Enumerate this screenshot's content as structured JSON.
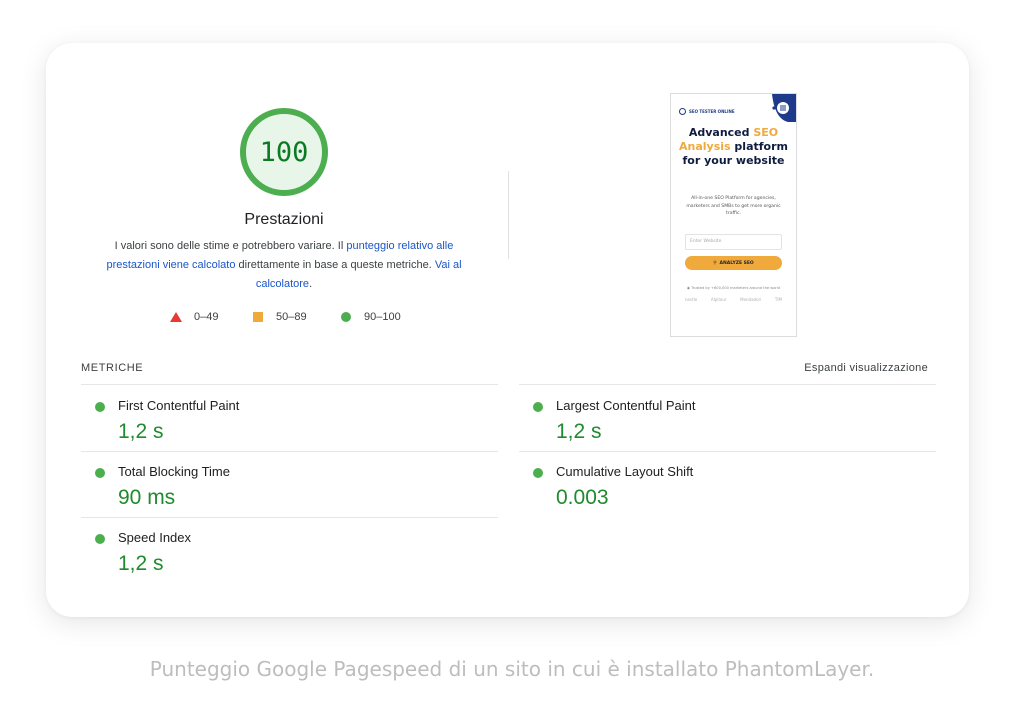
{
  "score": {
    "value": "100",
    "title": "Prestazioni",
    "fraction": 1.0,
    "color": "#0b7a23",
    "ring_color": "#4cae4f",
    "fill_color": "#e8f5e9"
  },
  "description": {
    "part1": "I valori sono delle stime e potrebbero variare. Il ",
    "link1": "punteggio relativo alle prestazioni viene calcolato",
    "part2": " direttamente in base a queste metriche. ",
    "link2": "Vai al calcolatore",
    "part3": "."
  },
  "legend": [
    {
      "shape": "triangle",
      "range": "0–49",
      "color": "#e53935"
    },
    {
      "shape": "square",
      "range": "50–89",
      "color": "#f0a93b"
    },
    {
      "shape": "circle",
      "range": "90–100",
      "color": "#4cae4f"
    }
  ],
  "preview": {
    "logo": "SEO TESTER ONLINE",
    "headline_1": "Advanced ",
    "headline_accent": "SEO Analysis",
    "headline_2": " platform for your website",
    "subtitle": "All-in-one SEO Platform for agencies, marketers and SMBs to get more organic traffic.",
    "input_placeholder": "Enter Website",
    "cta_label": "ANALYZE SEO",
    "trust_text": "Trusted by +600,000 marketers around the world",
    "brands": [
      "nestle",
      "Alpitour",
      "Mondadori",
      "TIM"
    ],
    "accent_color": "#f0a93b",
    "navy_color": "#0f1c3f"
  },
  "metrics_header": {
    "label": "METRICHE",
    "expand": "Espandi visualizzazione"
  },
  "metrics": [
    {
      "name": "First Contentful Paint",
      "value": "1,2 s",
      "status": "good"
    },
    {
      "name": "Largest Contentful Paint",
      "value": "1,2 s",
      "status": "good"
    },
    {
      "name": "Total Blocking Time",
      "value": "90 ms",
      "status": "good"
    },
    {
      "name": "Cumulative Layout Shift",
      "value": "0.003",
      "status": "good"
    },
    {
      "name": "Speed Index",
      "value": "1,2 s",
      "status": "good"
    }
  ],
  "caption": "Punteggio Google Pagespeed di un sito in cui è installato PhantomLayer."
}
